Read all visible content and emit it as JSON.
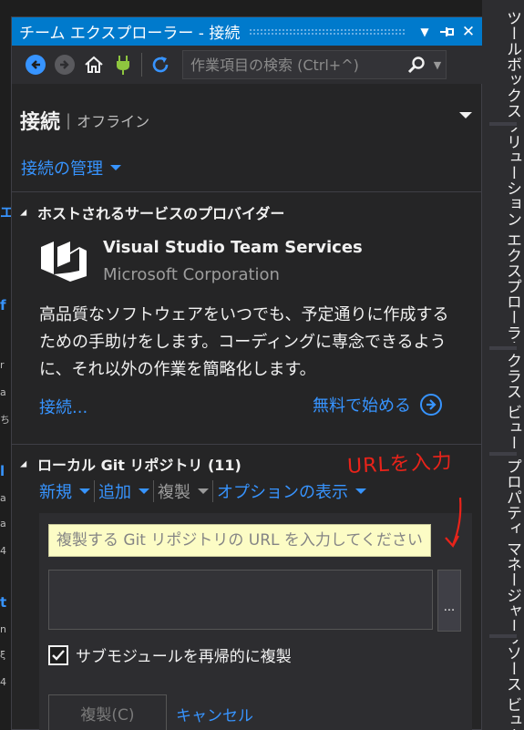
{
  "left_fragments": [
    "エ",
    "f",
    "r",
    "a",
    "ち",
    "l",
    "a",
    "a",
    "4",
    "t",
    "n",
    "ξ",
    "4"
  ],
  "window": {
    "title": "チーム エクスプローラー - 接続",
    "dropdown_glyph": "▼",
    "pin_glyph": "⊣",
    "close_glyph": "✕"
  },
  "toolbar": {
    "back_icon": "back-arrow-icon",
    "forward_icon": "forward-arrow-icon",
    "home_icon": "home-icon",
    "connect_icon": "plug-icon",
    "refresh_icon": "refresh-icon",
    "search_placeholder": "作業項目の検索 (Ctrl+^)",
    "search_icon": "search-icon"
  },
  "header": {
    "title": "接続",
    "separator": "|",
    "subtitle": "オフライン"
  },
  "manage_connections": "接続の管理",
  "hosted": {
    "section_title": "ホストされるサービスのプロバイダー",
    "provider_name": "Visual Studio Team Services",
    "provider_company": "Microsoft Corporation",
    "description": "高品質なソフトウェアをいつでも、予定通りに作成するための手助けをします。コーディングに専念できるように、それ以外の作業を簡略化します。",
    "connect_link": "接続...",
    "free_link": "無料で始める"
  },
  "local_git": {
    "section_title": "ローカル Git リポジトリ (11)",
    "actions": [
      {
        "label": "新規",
        "enabled": true
      },
      {
        "label": "追加",
        "enabled": true
      },
      {
        "label": "複製",
        "enabled": false
      },
      {
        "label": "オプションの表示",
        "enabled": true
      }
    ],
    "url_placeholder": "複製する Git リポジトリの URL を入力してください",
    "browse_label": "...",
    "recursive_label": "サブモジュールを再帰的に複製",
    "recursive_checked": true,
    "clone_button": "複製(C)",
    "cancel_link": "キャンセル"
  },
  "annotation": {
    "text": "URLを入力",
    "color": "#e8231a"
  },
  "right_tabs": [
    "ツールボックス",
    "ソリューション エクスプローラー",
    "クラス ビュー",
    "プロパティ マネージャー",
    "リソース ビュー"
  ],
  "colors": {
    "accent": "#007acc",
    "link": "#3794ff",
    "background": "#252526"
  }
}
